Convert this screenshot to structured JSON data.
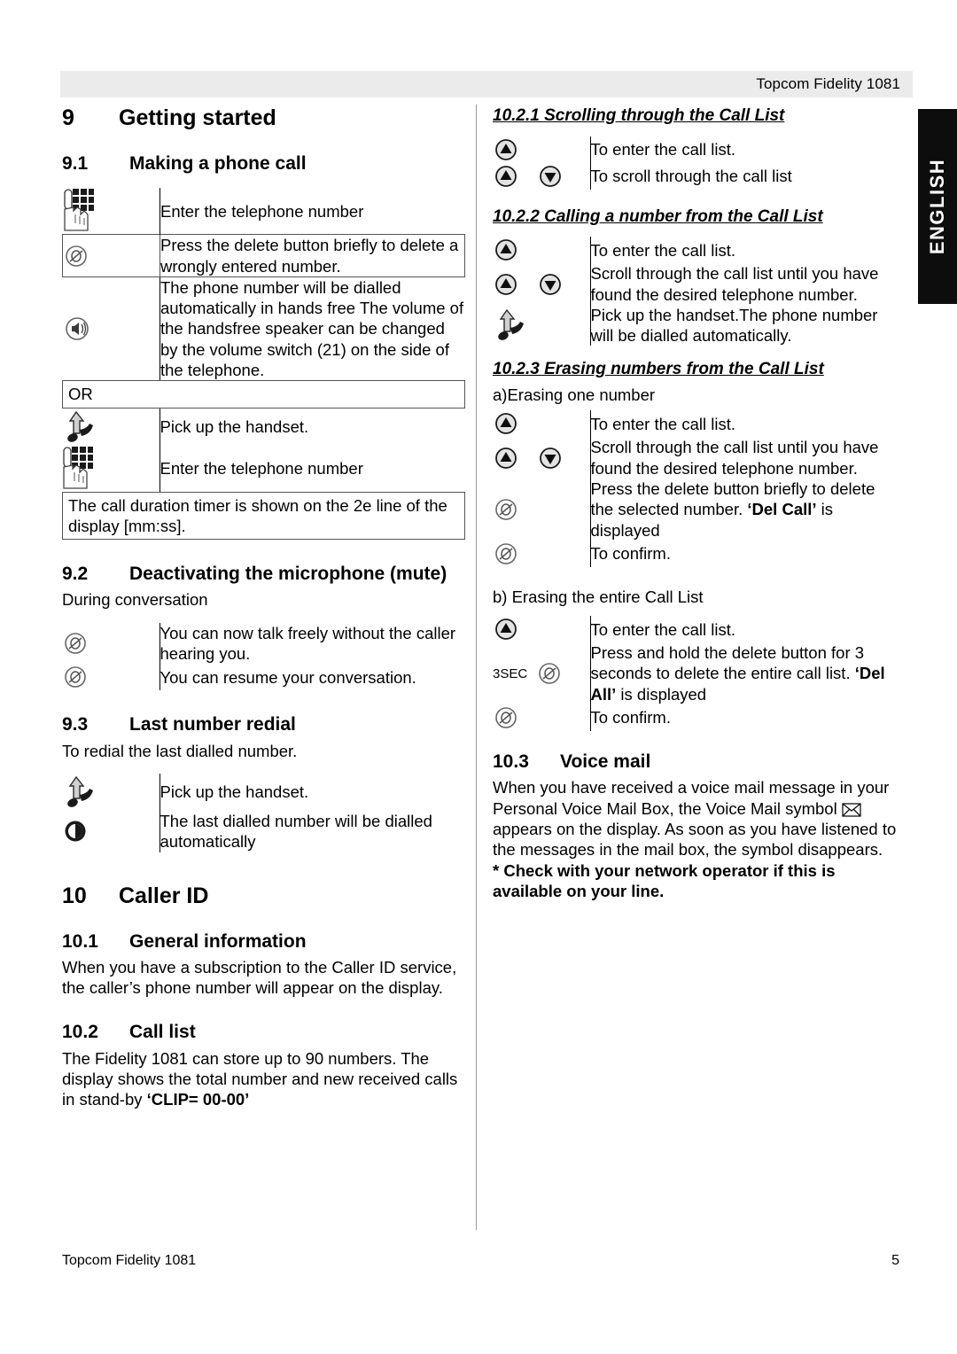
{
  "header": {
    "title": "Topcom Fidelity 1081"
  },
  "language_tab": {
    "label": "ENGLISH"
  },
  "footer": {
    "left": "Topcom Fidelity 1081",
    "page": "5"
  },
  "left_column": {
    "section9": {
      "number": "9",
      "title": "Getting started"
    },
    "section91": {
      "number": "9.1",
      "title": "Making a phone call",
      "rows": [
        {
          "icon": "keypad-hand-icon",
          "text": "Enter the telephone number",
          "boxed": false
        },
        {
          "icon": "delete-slash-icon",
          "text": "Press the delete button briefly to delete a wrongly entered number.",
          "boxed": true
        },
        {
          "icon": "speaker-icon",
          "text": "The phone number will be dialled automatically in hands free The volume of the handsfree speaker can be changed by the volume switch (21) on the side of the telephone.",
          "boxed": false
        }
      ],
      "or_label": "OR",
      "rows2": [
        {
          "icon": "handset-pickup-icon",
          "text": "Pick up the handset."
        },
        {
          "icon": "keypad-hand-icon",
          "text": "Enter the telephone number"
        }
      ],
      "note": "The call duration timer is shown on the 2e line of the display [mm:ss]."
    },
    "section92": {
      "number": "9.2",
      "title": "Deactivating the microphone (mute)",
      "intro": "During conversation",
      "rows": [
        {
          "icon": "delete-slash-icon",
          "text": "You can now talk freely without the caller hearing you."
        },
        {
          "icon": "delete-slash-icon",
          "text": "You can resume your conversation."
        }
      ]
    },
    "section93": {
      "number": "9.3",
      "title": "Last number redial",
      "intro": "To redial the last dialled number.",
      "rows": [
        {
          "icon": "handset-pickup-icon",
          "text": "Pick up the handset."
        },
        {
          "icon": "redial-icon",
          "text": "The last dialled number will be dialled automatically"
        }
      ]
    },
    "section10": {
      "number": "10",
      "title": "Caller ID"
    },
    "section101": {
      "number": "10.1",
      "title": "General information",
      "body": "When you have a subscription to the Caller ID service, the caller’s phone number will appear on the display."
    },
    "section102": {
      "number": "10.2",
      "title": "Call list",
      "body_a": "The Fidelity 1081 can store up to 90 numbers. The display shows the total number and new received calls in stand-by ",
      "body_bold": "‘CLIP= 00-00’"
    }
  },
  "right_column": {
    "section1021": {
      "heading": "10.2.1 Scrolling through the Call List",
      "rows": [
        {
          "icons": [
            "up-arrow-button-icon"
          ],
          "text": "To enter the call list."
        },
        {
          "icons": [
            "up-arrow-button-icon",
            "down-arrow-button-icon"
          ],
          "text": "To scroll through the call list"
        }
      ]
    },
    "section1022": {
      "heading": "10.2.2 Calling a number from the Call List",
      "rows": [
        {
          "icons": [
            "up-arrow-button-icon"
          ],
          "text": "To enter the call list."
        },
        {
          "icons": [
            "up-arrow-button-icon",
            "down-arrow-button-icon"
          ],
          "text": "Scroll through the call list until you have found the desired telephone number."
        },
        {
          "icons": [
            "handset-pickup-icon"
          ],
          "text": "Pick up the handset.The phone number will be dialled automatically."
        }
      ]
    },
    "section1023": {
      "heading": "10.2.3 Erasing numbers from the Call List",
      "sub_a": "a)Erasing one number",
      "rows_a": [
        {
          "icons": [
            "up-arrow-button-icon"
          ],
          "text": "To enter the call list.",
          "bold_tail": ""
        },
        {
          "icons": [
            "up-arrow-button-icon",
            "down-arrow-button-icon"
          ],
          "text": "Scroll through the call list until you have found the desired telephone number.",
          "bold_tail": ""
        },
        {
          "icons": [
            "delete-slash-icon"
          ],
          "text": "Press the delete button briefly to delete the selected number. ",
          "bold_tail": "‘Del Call’",
          "tail": " is displayed"
        },
        {
          "icons": [
            "delete-slash-icon"
          ],
          "text": "To confirm.",
          "bold_tail": ""
        }
      ],
      "sub_b": "b) Erasing the entire Call List",
      "rows_b": [
        {
          "icons": [
            "up-arrow-button-icon"
          ],
          "text": "To enter the call list.",
          "prefix": "",
          "bold_tail": ""
        },
        {
          "icons": [
            "delete-slash-icon"
          ],
          "prefix": "3SEC",
          "text": "Press and hold the delete button for 3 seconds to delete the entire call list. ",
          "bold_tail": "‘Del All’",
          "tail": " is displayed"
        },
        {
          "icons": [
            "delete-slash-icon"
          ],
          "prefix": "",
          "text": "To confirm.",
          "bold_tail": ""
        }
      ]
    },
    "section103": {
      "number": "10.3",
      "title": "Voice mail",
      "body_1": "When you have received a voice mail message in your Personal Voice Mail Box, the Voice Mail symbol ",
      "envelope_icon": "envelope-icon",
      "body_2": " appears on the display. As soon as you have listened to the messages in the mail box, the symbol disappears.",
      "note_bold": "* Check with your network operator if this is available on your line."
    }
  },
  "colors": {
    "header_bar": "#ebebeb",
    "lang_tab_bg": "#0d0d0d",
    "text": "#000000"
  }
}
